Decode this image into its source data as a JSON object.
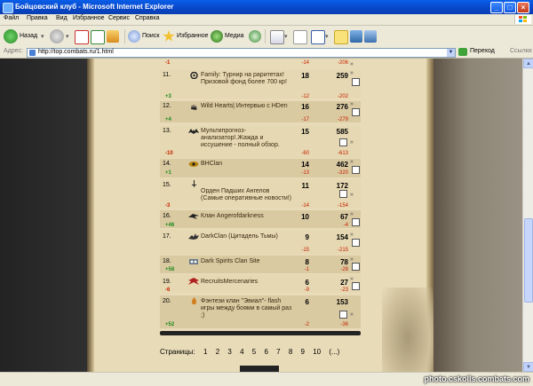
{
  "window": {
    "title": "Бойцовский клуб - Microsoft Internet Explorer",
    "controls": [
      "_",
      "□",
      "×"
    ]
  },
  "menu": [
    "Файл",
    "Правка",
    "Вид",
    "Избранное",
    "Сервис",
    "Справка"
  ],
  "toolbar": {
    "back_label": "Назад",
    "search_label": "Поиск",
    "favorites_label": "Избранное",
    "media_label": "Медиа"
  },
  "address": {
    "label": "Адрес:",
    "url": "http://top.combats.ru/1.html",
    "go_label": "Переход",
    "links_label": "Ссылки"
  },
  "top_row": {
    "delta_rank": "-1",
    "delta_votes": "-14",
    "delta_score": "-206",
    "arrows": "»"
  },
  "rows": [
    {
      "rank": "11.",
      "name": "Family: Турнир на раритетах! Призовой фонд более 700 кр!",
      "votes": "18",
      "score": "259",
      "delta_rank": "+3",
      "delta_votes": "-12",
      "delta_score": "-202",
      "icon": "swirl-icon"
    },
    {
      "rank": "12.",
      "name": "Wild Hearts| Интервью с HDen",
      "votes": "16",
      "score": "276",
      "delta_rank": "+4",
      "delta_votes": "-17",
      "delta_score": "-279",
      "icon": "hand-icon"
    },
    {
      "rank": "13.",
      "name": "Мультипрогноз-анализатор!.Жажда и иссушение - полный обзор.",
      "votes": "15",
      "score": "585",
      "delta_rank": "-10",
      "delta_votes": "-60",
      "delta_score": "-613",
      "icon": "bat-icon"
    },
    {
      "rank": "14.",
      "name": "BHClan",
      "votes": "14",
      "score": "462",
      "delta_rank": "+1",
      "delta_votes": "-13",
      "delta_score": "-320",
      "icon": "eye-icon"
    },
    {
      "rank": "15.",
      "name": "Орден Падших Ангелов (Самые оперативные новости!)",
      "votes": "11",
      "score": "172",
      "delta_rank": "-3",
      "delta_votes": "-14",
      "delta_score": "-154",
      "icon": "sword-icon"
    },
    {
      "rank": "16.",
      "name": "Клан Angerofdarkness",
      "votes": "10",
      "score": "67",
      "delta_rank": "+46",
      "delta_votes": "",
      "delta_score": "-4",
      "icon": "wing-icon"
    },
    {
      "rank": "17.",
      "name": "DarkClan (Цитадель Тьмы)",
      "votes": "9",
      "score": "154",
      "delta_rank": "",
      "delta_votes": "-15",
      "delta_score": "-215",
      "icon": "dragon-icon"
    },
    {
      "rank": "18.",
      "name": "Dark Spirits Clan Site",
      "votes": "8",
      "score": "78",
      "delta_rank": "+58",
      "delta_votes": "-1",
      "delta_score": "-28",
      "icon": "spirit-icon"
    },
    {
      "rank": "19.",
      "name": "RecruitsMercenaries",
      "votes": "6",
      "score": "27",
      "delta_rank": "-6",
      "delta_votes": "-9",
      "delta_score": "-23",
      "icon": "mercenary-icon"
    },
    {
      "rank": "20.",
      "name": "Фэнтези клан \"Эвиал\"- flash игры между боями в самый раз ;)",
      "votes": "6",
      "score": "153",
      "delta_rank": "+52",
      "delta_votes": "-2",
      "delta_score": "-36",
      "icon": "flame-icon"
    }
  ],
  "pagination": {
    "label": "Страницы:",
    "pages": [
      "1",
      "2",
      "3",
      "4",
      "5",
      "6",
      "7",
      "8",
      "9",
      "10",
      "(...)"
    ]
  },
  "watermark": "photo.cskolls.combats.com",
  "colors": {
    "positive": "#1a8a1a",
    "negative": "#c62000",
    "parchment": "#e8dbb8"
  }
}
